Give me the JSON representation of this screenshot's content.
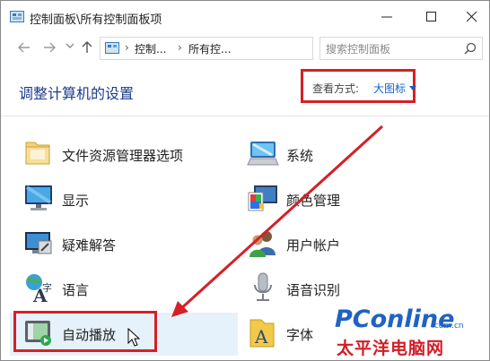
{
  "window": {
    "title": "控制面板\\所有控制面板项"
  },
  "address": {
    "crumbs": [
      "控制...",
      "所有控...",
      "›"
    ],
    "search_placeholder": "搜索控制面板"
  },
  "header": {
    "title": "调整计算机的设置",
    "view_label": "查看方式:",
    "view_value": "大图标"
  },
  "items": [
    {
      "label": "文件资源管理器选项",
      "icon": "folder-options-icon"
    },
    {
      "label": "系统",
      "icon": "system-icon"
    },
    {
      "label": "显示",
      "icon": "display-icon"
    },
    {
      "label": "颜色管理",
      "icon": "color-management-icon"
    },
    {
      "label": "疑难解答",
      "icon": "troubleshooting-icon"
    },
    {
      "label": "用户帐户",
      "icon": "user-accounts-icon"
    },
    {
      "label": "语言",
      "icon": "language-icon"
    },
    {
      "label": "语音识别",
      "icon": "speech-recognition-icon"
    },
    {
      "label": "自动播放",
      "icon": "autoplay-icon"
    },
    {
      "label": "字体",
      "icon": "fonts-icon"
    }
  ],
  "watermark": {
    "brand": "PConline",
    "domain": ".com.cn",
    "chinese": "太平洋电脑网"
  },
  "colors": {
    "highlight_red": "#d61f26",
    "link_blue": "#1660c7",
    "heading_blue": "#1e3a8a",
    "selection_bg": "#e5f1fb"
  }
}
